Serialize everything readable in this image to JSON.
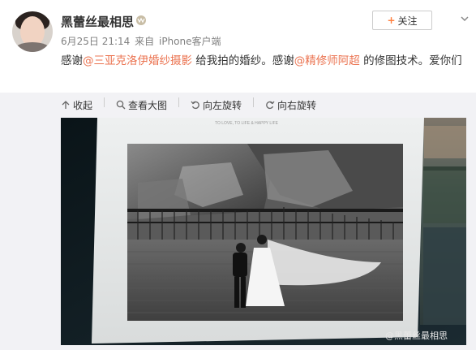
{
  "header": {
    "username": "黑蕾丝最相思",
    "follow_label": "关注",
    "meta_date": "6月25日 21:14",
    "meta_from": "来自",
    "meta_client": "iPhone客户端"
  },
  "post": {
    "text_1": "感谢",
    "mention_1": "@三亚克洛伊婚纱摄影",
    "text_2": " 给我拍的婚纱。感谢",
    "mention_2": "@精修师阿超",
    "text_3": " 的修图技术。爱你们"
  },
  "toolbar": {
    "collapse_label": "收起",
    "view_large_label": "查看大图",
    "rotate_left_label": "向左旋转",
    "rotate_right_label": "向右旋转"
  },
  "photo": {
    "page_caption": "TO LOVE, TO LIFE & HAPPY LIFE",
    "watermark": "@黑蕾丝最相思"
  },
  "colors": {
    "link": "#eb7350",
    "follow_plus": "#ff8140",
    "vip_icon": "#b0a58f"
  }
}
